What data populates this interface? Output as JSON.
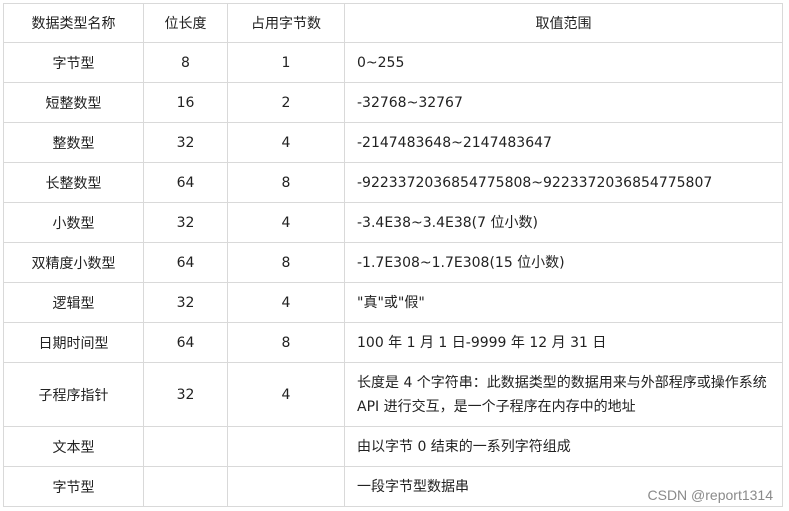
{
  "headers": [
    "数据类型名称",
    "位长度",
    "占用字节数",
    "取值范围"
  ],
  "rows": [
    {
      "name": "字节型",
      "bits": "8",
      "bytes": "1",
      "range": "0~255"
    },
    {
      "name": "短整数型",
      "bits": "16",
      "bytes": "2",
      "range": "-32768~32767"
    },
    {
      "name": "整数型",
      "bits": "32",
      "bytes": "4",
      "range": "-2147483648~2147483647"
    },
    {
      "name": "长整数型",
      "bits": "64",
      "bytes": "8",
      "range": "-9223372036854775808~9223372036854775807"
    },
    {
      "name": "小数型",
      "bits": "32",
      "bytes": "4",
      "range": "-3.4E38~3.4E38(7 位小数)"
    },
    {
      "name": "双精度小数型",
      "bits": "64",
      "bytes": "8",
      "range": "-1.7E308~1.7E308(15 位小数)"
    },
    {
      "name": "逻辑型",
      "bits": "32",
      "bytes": "4",
      "range": "\"真\"或\"假\""
    },
    {
      "name": "日期时间型",
      "bits": "64",
      "bytes": "8",
      "range": "100 年 1 月 1 日-9999 年 12 月 31 日"
    },
    {
      "name": "子程序指针",
      "bits": "32",
      "bytes": "4",
      "range": "长度是 4 个字符串：此数据类型的数据用来与外部程序或操作系统 API 进行交互，是一个子程序在内存中的地址"
    },
    {
      "name": "文本型",
      "bits": "",
      "bytes": "",
      "range": "由以字节 0 结束的一系列字符组成"
    },
    {
      "name": "字节型",
      "bits": "",
      "bytes": "",
      "range": "一段字节型数据串"
    }
  ],
  "watermark": "CSDN @report1314"
}
